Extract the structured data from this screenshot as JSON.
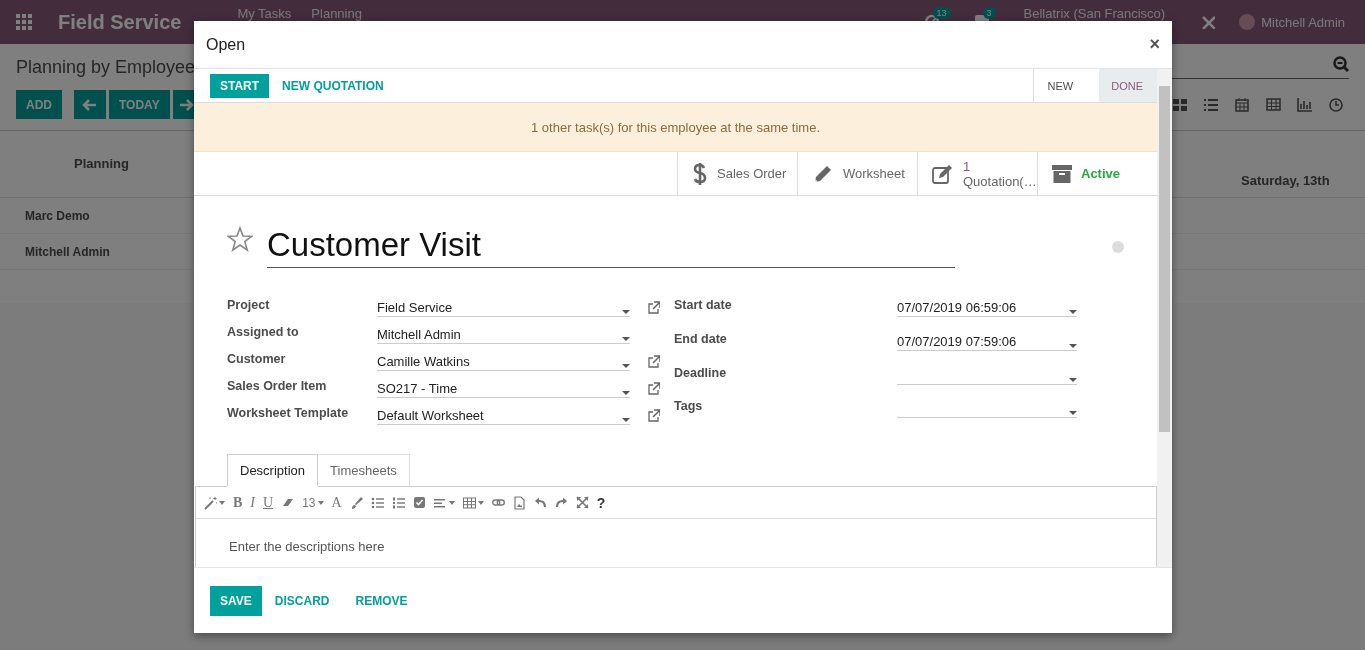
{
  "navbar": {
    "app_title": "Field Service",
    "menu": [
      "My Tasks",
      "Planning"
    ],
    "activity_count": "13",
    "message_count": "3",
    "company": "Bellatrix (San Francisco)",
    "user": "Mitchell Admin"
  },
  "control_panel": {
    "breadcrumb": "Planning by Employee",
    "add_button": "ADD",
    "today_button": "TODAY"
  },
  "gantt": {
    "header": "Planning",
    "date_column": "Saturday, 13th",
    "rows": [
      "Marc Demo",
      "Mitchell Admin"
    ]
  },
  "dialog": {
    "title": "Open",
    "close": "×",
    "header_buttons": [
      {
        "label": "START",
        "kind": "primary"
      },
      {
        "label": "NEW QUOTATION",
        "kind": "link"
      }
    ],
    "stages": [
      {
        "label": "NEW",
        "selected": false
      },
      {
        "label": "DONE",
        "selected": true
      }
    ],
    "alert": "1 other task(s) for this employee at the same time.",
    "smart_buttons": [
      {
        "label": "Sales Order"
      },
      {
        "label": "Worksheet"
      },
      {
        "count": "1",
        "label": "Quotation(…"
      },
      {
        "label": "Active",
        "active": true
      }
    ],
    "task_title": "Customer Visit",
    "starred": false,
    "fields_left": [
      {
        "label": "Project",
        "value": "Field Service",
        "external_link": true
      },
      {
        "label": "Assigned to",
        "value": "Mitchell Admin",
        "external_link": false
      },
      {
        "label": "Customer",
        "value": "Camille Watkins",
        "external_link": true
      },
      {
        "label": "Sales Order Item",
        "value": "SO217 - Time",
        "external_link": true
      },
      {
        "label": "Worksheet Template",
        "value": "Default Worksheet",
        "external_link": true
      }
    ],
    "fields_right": [
      {
        "label": "Start date",
        "value": "07/07/2019 06:59:06"
      },
      {
        "label": "End date",
        "value": "07/07/2019 07:59:06"
      },
      {
        "label": "Deadline"
      },
      {
        "label": "Tags"
      }
    ],
    "tabs": [
      {
        "label": "Description",
        "selected": true
      },
      {
        "label": "Timesheets",
        "selected": false
      }
    ],
    "toolbar": [
      {
        "kind": "magic",
        "dropdown": true
      },
      {
        "kind": "bold",
        "text": "B"
      },
      {
        "kind": "italic",
        "text": "I"
      },
      {
        "kind": "underline",
        "text": "U"
      },
      {
        "kind": "eraser"
      },
      {
        "kind": "fontsize",
        "text": "13",
        "dropdown": true
      },
      {
        "kind": "color",
        "text": "A"
      },
      {
        "kind": "brush"
      },
      {
        "kind": "bullets"
      },
      {
        "kind": "numbers"
      },
      {
        "kind": "checkbox"
      },
      {
        "kind": "align",
        "dropdown": true
      },
      {
        "kind": "table",
        "dropdown": true
      },
      {
        "kind": "link"
      },
      {
        "kind": "file"
      },
      {
        "kind": "undo"
      },
      {
        "kind": "redo"
      },
      {
        "kind": "expand"
      },
      {
        "kind": "help",
        "text": "?"
      }
    ],
    "editor_placeholder": "Enter the descriptions here",
    "footer_buttons": [
      {
        "label": "SAVE",
        "kind": "primary"
      },
      {
        "label": "DISCARD",
        "kind": "link"
      },
      {
        "label": "REMOVE",
        "kind": "link"
      }
    ]
  }
}
